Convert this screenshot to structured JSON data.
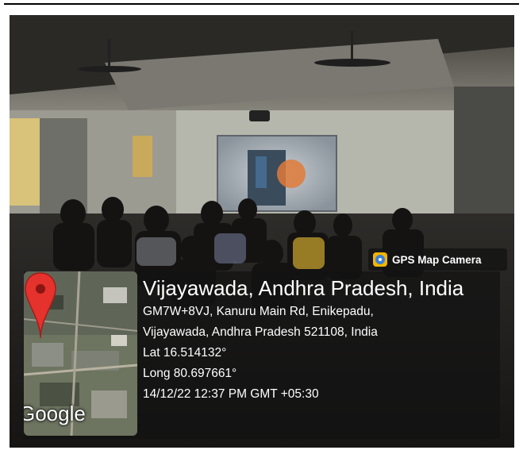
{
  "overlay": {
    "badge_label": "GPS Map Camera",
    "badge_icon": "gps-map-camera-icon",
    "location_title": "Vijayawada, Andhra Pradesh, India",
    "address_line1": "GM7W+8VJ, Kanuru Main Rd, Enikepadu,",
    "address_line2": "Vijayawada, Andhra Pradesh 521108, India",
    "latitude": "Lat 16.514132°",
    "longitude": "Long 80.697661°",
    "timestamp": "14/12/22 12:37 PM GMT +05:30"
  },
  "map": {
    "logo_text": "Google",
    "pin_icon": "map-pin-icon",
    "pin_color": "#e5322d"
  }
}
